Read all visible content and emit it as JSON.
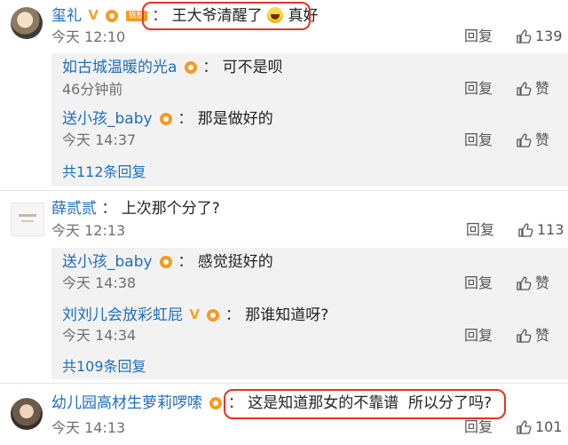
{
  "comments": [
    {
      "name": "玺礼",
      "colon": "：",
      "text_before": "王大爷清醒了",
      "text_after": "真好",
      "fan_label": "铁粉",
      "time": "今天 12:10",
      "reply": "回复",
      "likes": "139",
      "replies": [
        {
          "name": "如古城温暖的光a",
          "colon": "：",
          "text": "可不是呗",
          "time": "46分钟前",
          "reply": "回复",
          "like": "赞"
        },
        {
          "name": "送小孩_baby",
          "colon": "：",
          "text": "那是做好的",
          "time": "今天 14:37",
          "reply": "回复",
          "like": "赞"
        }
      ],
      "more": "共112条回复"
    },
    {
      "name": "薛贰贰",
      "colon": "：",
      "text": "上次那个分了?",
      "time": "今天 12:13",
      "reply": "回复",
      "likes": "113",
      "replies": [
        {
          "name": "送小孩_baby",
          "colon": "：",
          "text": "感觉挺好的",
          "time": "今天 14:38",
          "reply": "回复",
          "like": "赞"
        },
        {
          "name": "刘刘儿会放彩虹屁",
          "colon": "：",
          "text": "那谁知道呀?",
          "time": "今天 14:34",
          "reply": "回复",
          "like": "赞"
        }
      ],
      "more": "共109条回复"
    },
    {
      "name": "幼儿园高材生萝莉啰嗦",
      "colon": "：",
      "text": "这是知道那女的不靠谱  所以分了吗?",
      "time": "今天 14:13",
      "reply": "回复",
      "likes": "101"
    }
  ],
  "colors": {
    "name": "#1f6fb8",
    "highlight": "#e8322b",
    "badge": "#f59a23"
  },
  "icons": {
    "like": "thumbs-up-icon",
    "fan_badge": "crown-badge-icon",
    "verified": "v-badge-icon"
  }
}
